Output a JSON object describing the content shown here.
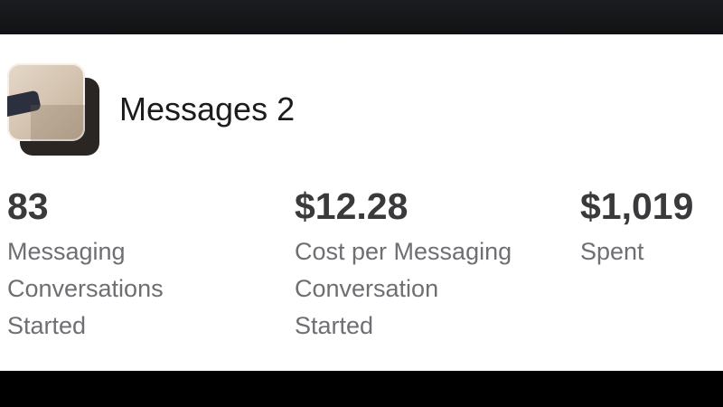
{
  "ad": {
    "name": "Messages 2"
  },
  "metrics": [
    {
      "value": "83",
      "label_lines": [
        "Messaging",
        "Conversations",
        "Started"
      ]
    },
    {
      "value": "$12.28",
      "label_lines": [
        "Cost per Messaging",
        "Conversation",
        "Started"
      ]
    },
    {
      "value": "$1,019",
      "label_lines": [
        "Spent"
      ]
    }
  ],
  "colors": {
    "background": "#ffffff",
    "value_text": "#3a3a3c",
    "label_text": "#6e6e73",
    "title_text": "#1c1c1e"
  },
  "icons": {
    "ad_thumbnail": "ad-thumbnail-image"
  }
}
